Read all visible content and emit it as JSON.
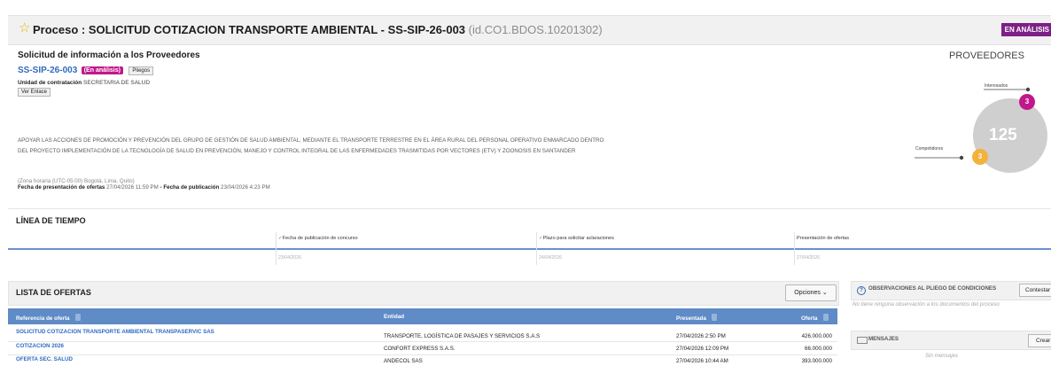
{
  "header": {
    "title": "Proceso : SOLICITUD COTIZACION TRANSPORTE AMBIENTAL - SS-SIP-26-003",
    "id_text": "(id.CO1.BDOS.10201302)",
    "status_badge": "EN ANÁLISIS"
  },
  "info": {
    "heading": "Solicitud de información a los Proveedores",
    "code": "SS-SIP-26-003",
    "status_pill": "(En análisis)",
    "pliegos_button": "Pliegos",
    "unit_label": "Unidad de contratación",
    "unit_value": "SECRETARIA DE SALUD",
    "ver_enlace": "Ver Enlace",
    "description_line1": "APOYAR LAS ACCIONES DE PROMOCIÓN Y PREVENCIÓN DEL GRUPO DE GESTIÓN DE SALUD AMBIENTAL, MEDIANTE EL TRANSPORTE TERRESTRE EN EL ÁREA RURAL DEL PERSONAL OPERATIVO ENMARCADO DENTRO",
    "description_line2": "DEL PROYECTO IMPLEMENTACIÓN DE LA TECNOLOGÍA DE SALUD EN PREVENCIÓN, MANEJO Y CONTROL INTEGRAL DE LAS ENFERMEDADES TRASMITIDAS POR VECTORES (ETV) Y ZOONOSIS EN SANTANDER",
    "timezone": "(Zona horaria (UTC-05:00) Bogotá, Lima, Quito)",
    "offers_date_label": "Fecha de presentación de ofertas",
    "offers_date_value": "27/04/2026 11:59 PM",
    "separator": "-",
    "publication_label": "Fecha de publicación",
    "publication_value": "23/04/2026 4:23 PM"
  },
  "proveedores": {
    "title": "PROVEEDORES",
    "total": "125",
    "interesados_label": "Interesados",
    "interesados_count": "3",
    "competidores_label": "Competidores",
    "competidores_count": "3"
  },
  "timeline": {
    "title": "LÍNEA DE TIEMPO",
    "events": [
      {
        "label": "Fecha de publicación de concurso",
        "date": "23/04/2026"
      },
      {
        "label": "Plazo para solicitar aclaraciones",
        "date": "24/04/2026"
      },
      {
        "label": "Presentación de ofertas",
        "date": "27/04/2026"
      }
    ]
  },
  "offers": {
    "title": "LISTA DE OFERTAS",
    "options_button": "Opciones",
    "columns": [
      "Referencia de oferta",
      "Entidad",
      "Presentada",
      "Oferta"
    ],
    "rows": [
      {
        "ref": "SOLICITUD COTIZACION TRANSPORTE AMBIENTAL TRANSPASERVIC SAS",
        "entity": "TRANSPORTE, LOGÍSTICA DE PASAJES Y SERVICIOS S.A.S",
        "date": "27/04/2026 2:50 PM",
        "amount": "426.000.000"
      },
      {
        "ref": "COTIZACION 2026",
        "entity": "CONFORT EXPRESS S.A.S.",
        "date": "27/04/2026 12:09 PM",
        "amount": "66.000.000"
      },
      {
        "ref": "OFERTA SEC. SALUD",
        "entity": "ANDECOL SAS",
        "date": "27/04/2026 10:44 AM",
        "amount": "393.000.000"
      }
    ]
  },
  "observaciones": {
    "title": "OBSERVACIONES AL PLIEGO DE CONDICIONES",
    "button": "Contestar",
    "empty": "No tiene ninguna observación a los documentos del proceso"
  },
  "mensajes": {
    "title": "MENSAJES",
    "button": "Crear",
    "empty": "Sin mensajes"
  }
}
